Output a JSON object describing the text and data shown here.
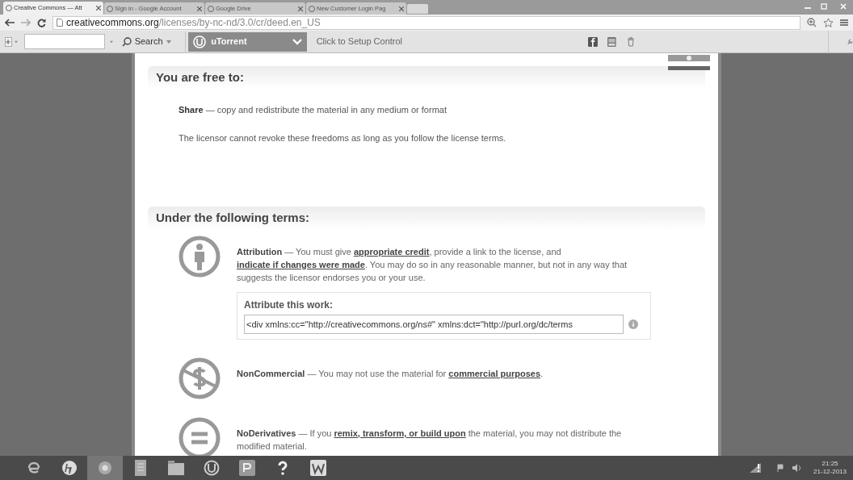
{
  "tabs": [
    {
      "label": "Creative Commons — Att",
      "selected": true
    },
    {
      "label": "Sign in - Google Account",
      "selected": false
    },
    {
      "label": "Google Drive",
      "selected": false
    },
    {
      "label": "New Customer Login Pag",
      "selected": false
    }
  ],
  "address_bar": {
    "host": "creativecommons.org",
    "path": "/licenses/by-nc-nd/3.0/cr/deed.en_US"
  },
  "toolbar": {
    "search_button": "Search",
    "utorrent_label": "uTorrent",
    "setup_text": "Click to Setup Control"
  },
  "free_section": {
    "heading": "You are free to:",
    "items": [
      {
        "name": "Share",
        "text": " — copy and redistribute the material in any medium or format"
      }
    ],
    "note": "The licensor cannot revoke these freedoms as long as you follow the license terms."
  },
  "terms_section": {
    "heading": "Under the following terms:",
    "terms": [
      {
        "kind": "attribution",
        "name": "Attribution",
        "segments": [
          {
            "text": " — You must give ",
            "link": false
          },
          {
            "text": "appropriate credit",
            "link": true
          },
          {
            "text": ", provide a link to the license, and ",
            "link": false
          },
          {
            "text": "indicate if changes were made",
            "link": true
          },
          {
            "text": ". You may do so in any reasonable manner, but not in any way that suggests the licensor endorses you or your use.",
            "link": false
          }
        ],
        "attribute_box": {
          "label": "Attribute this work:",
          "value": "<div xmlns:cc=\"http://creativecommons.org/ns#\" xmlns:dct=\"http://purl.org/dc/terms"
        }
      },
      {
        "kind": "noncommercial",
        "name": "NonCommercial",
        "segments": [
          {
            "text": " — You may not use the material for ",
            "link": false
          },
          {
            "text": "commercial purposes",
            "link": true
          },
          {
            "text": ".",
            "link": false
          }
        ]
      },
      {
        "kind": "noderivatives",
        "name": "NoDerivatives",
        "segments": [
          {
            "text": " — If you ",
            "link": false
          },
          {
            "text": "remix, transform, or build upon",
            "link": true
          },
          {
            "text": " the material, you may not distribute the modified material.",
            "link": false
          }
        ]
      }
    ]
  },
  "taskbar": {
    "apps": [
      {
        "kind": "ie",
        "selected": false
      },
      {
        "kind": "hp",
        "selected": false
      },
      {
        "kind": "chrome",
        "selected": true
      },
      {
        "kind": "doc",
        "selected": false
      },
      {
        "kind": "folder",
        "selected": false
      },
      {
        "kind": "utorrent",
        "selected": false
      },
      {
        "kind": "publisher",
        "selected": false
      },
      {
        "kind": "help",
        "selected": false
      },
      {
        "kind": "word",
        "selected": false
      }
    ],
    "time": "21:25",
    "date": "21-12-2013"
  }
}
